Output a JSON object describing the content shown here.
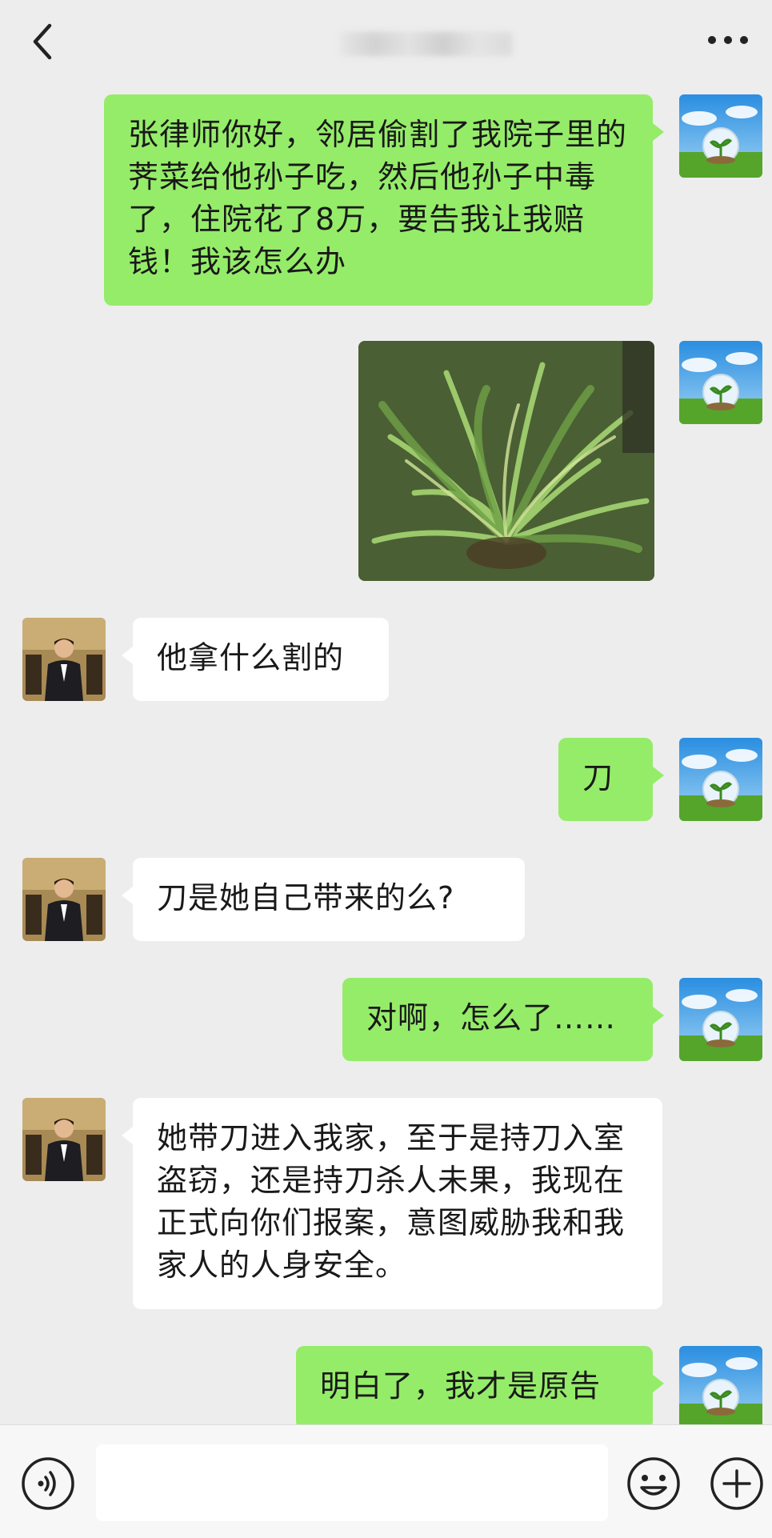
{
  "header": {
    "title": "",
    "back_icon": "chevron-left-icon",
    "more_icon": "more-dots-icon"
  },
  "messages": [
    {
      "from": "me",
      "type": "text",
      "text": "张律师你好，邻居偷割了我院子里的荠菜给他孙子吃，然后他孙子中毒了，住院花了8万，要告我让我赔钱！我该怎么办"
    },
    {
      "from": "me",
      "type": "image",
      "alt": "photo of wild greens"
    },
    {
      "from": "lawyer",
      "type": "text",
      "text": "他拿什么割的"
    },
    {
      "from": "me",
      "type": "text",
      "text": "刀"
    },
    {
      "from": "lawyer",
      "type": "text",
      "text": "刀是她自己带来的么?"
    },
    {
      "from": "me",
      "type": "text",
      "text": "对啊，怎么了……"
    },
    {
      "from": "lawyer",
      "type": "text",
      "text": "她带刀进入我家，至于是持刀入室盗窃，还是持刀杀人未果，我现在正式向你们报案，意图威胁我和我家人的人身安全。"
    },
    {
      "from": "me",
      "type": "text",
      "text": "明白了，我才是原告"
    }
  ],
  "input_bar": {
    "voice_icon": "voice-icon",
    "emoji_icon": "emoji-icon",
    "plus_icon": "plus-icon",
    "placeholder": ""
  },
  "colors": {
    "background": "#ededed",
    "outgoing_bubble": "#95ec69",
    "incoming_bubble": "#ffffff",
    "input_bar": "#f7f7f7"
  }
}
